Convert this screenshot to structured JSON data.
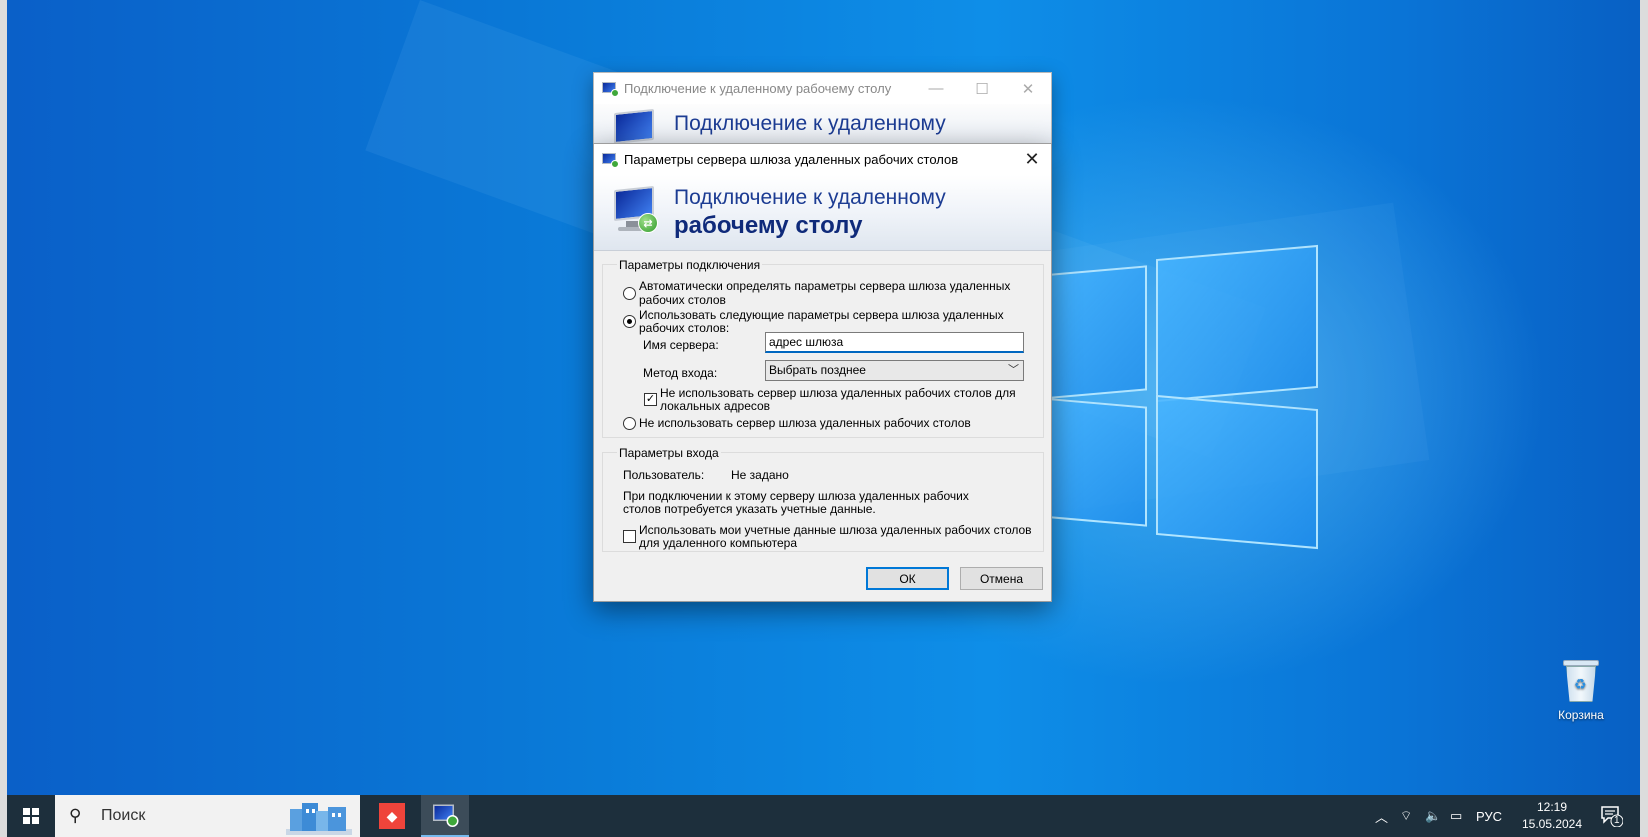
{
  "desktop": {
    "recycle_bin_label": "Корзина"
  },
  "back_window": {
    "title": "Подключение к удаленному рабочему столу",
    "banner_line1": "Подключение к удаленному"
  },
  "dialog": {
    "title": "Параметры сервера шлюза удаленных рабочих столов",
    "banner_line1": "Подключение к удаленному",
    "banner_line2": "рабочему столу",
    "connection_group": {
      "title": "Параметры подключения",
      "option_auto_line1": "Автоматически определять параметры сервера шлюза удаленных",
      "option_auto_line2": "рабочих столов",
      "option_use_line1": "Использовать следующие параметры сервера шлюза удаленных",
      "option_use_line2": "рабочих столов:",
      "server_name_label": "Имя сервера:",
      "server_name_value": "адрес шлюза",
      "logon_method_label": "Метод входа:",
      "logon_method_value": "Выбрать позднее",
      "bypass_local_line1": "Не использовать сервер шлюза удаленных рабочих столов для",
      "bypass_local_line2": "локальных адресов",
      "bypass_local_checked": true,
      "option_none": "Не использовать сервер шлюза удаленных рабочих столов",
      "selected_option": "use"
    },
    "logon_group": {
      "title": "Параметры входа",
      "user_label": "Пользователь:",
      "user_value": "Не задано",
      "info_line1": "При подключении к этому серверу шлюза удаленных рабочих",
      "info_line2": "столов потребуется указать учетные данные.",
      "use_creds_line1": "Использовать мои учетные данные шлюза удаленных рабочих столов",
      "use_creds_line2": "для удаленного компьютера",
      "use_creds_checked": false
    },
    "ok_label": "ОК",
    "cancel_label": "Отмена"
  },
  "taskbar": {
    "search_placeholder": "Поиск",
    "language": "РУС",
    "time": "12:19",
    "date": "15.05.2024",
    "notification_count": "1"
  }
}
